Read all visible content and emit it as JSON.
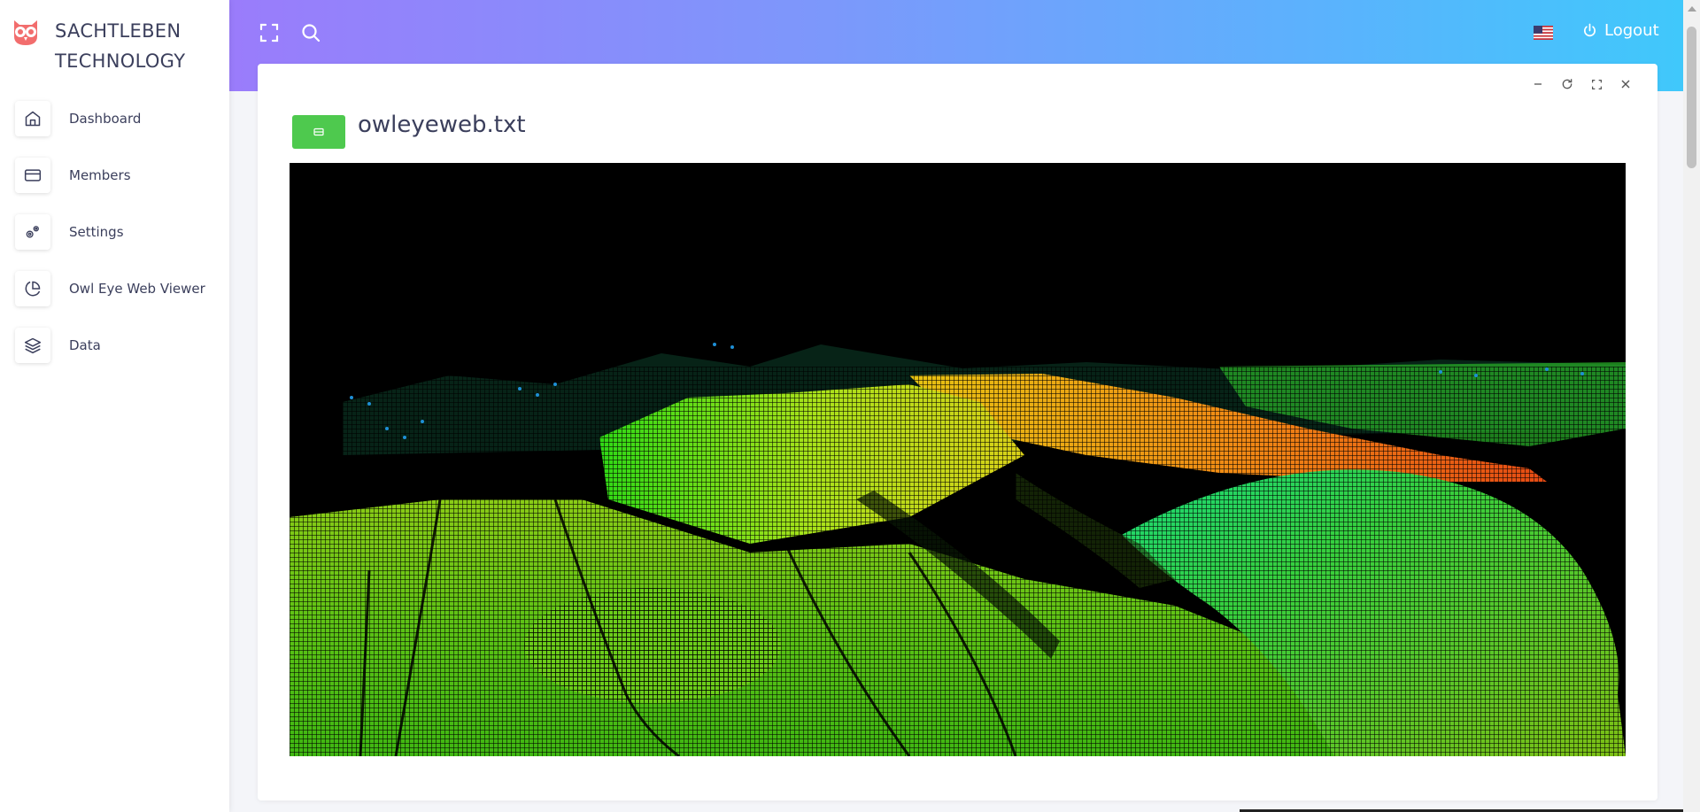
{
  "brand": {
    "name": "SACHTLEBEN TECHNOLOGY",
    "logo_icon": "owl-icon",
    "logo_color": "#f26d6d"
  },
  "sidebar": {
    "items": [
      {
        "label": "Dashboard",
        "icon": "home-icon"
      },
      {
        "label": "Members",
        "icon": "credit-card-icon"
      },
      {
        "label": "Settings",
        "icon": "gears-icon"
      },
      {
        "label": "Owl Eye Web Viewer",
        "icon": "pie-chart-icon"
      },
      {
        "label": "Data",
        "icon": "layers-icon"
      }
    ]
  },
  "topbar": {
    "fullscreen_icon": "expand-icon",
    "search_icon": "search-icon",
    "language_icon": "us-flag-icon",
    "logout_label": "Logout",
    "gradient": [
      "#9a7cfb",
      "#40c8fb"
    ]
  },
  "card": {
    "tools": [
      "minimize-icon",
      "refresh-icon",
      "maximize-icon",
      "close-icon"
    ],
    "file_badge_color": "#4ec94e",
    "file_name": "owleyeweb.txt"
  },
  "viewer": {
    "content": "point-cloud-render",
    "background": "#000000"
  }
}
